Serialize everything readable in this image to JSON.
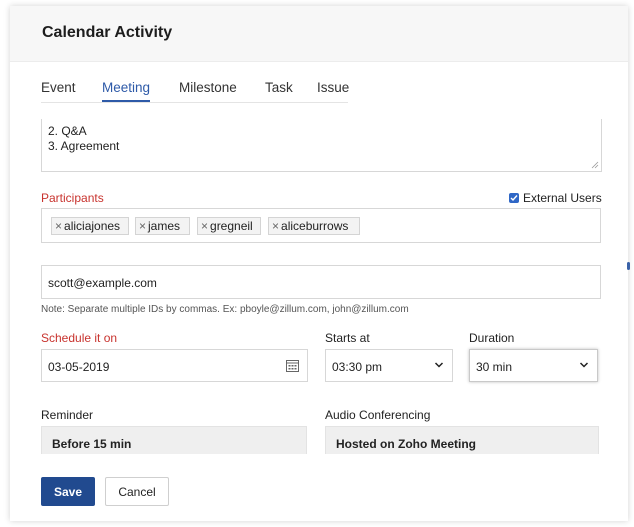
{
  "dialog": {
    "title": "Calendar Activity"
  },
  "tabs": [
    {
      "label": "Event"
    },
    {
      "label": "Meeting"
    },
    {
      "label": "Milestone"
    },
    {
      "label": "Task"
    },
    {
      "label": "Issue"
    }
  ],
  "active_tab": "Meeting",
  "description": {
    "lines": [
      "2. Q&A",
      "3. Agreement"
    ]
  },
  "participants": {
    "label": "Participants",
    "external_users_label": "External Users",
    "external_users_checked": true,
    "chips": [
      "aliciajones",
      "james",
      "gregneil",
      "aliceburrows"
    ]
  },
  "external_emails": {
    "value": "scott@example.com",
    "note": "Note: Separate multiple IDs by commas. Ex: pboyle@zillum.com, john@zillum.com"
  },
  "schedule": {
    "label": "Schedule it on",
    "date": "03-05-2019",
    "starts_at_label": "Starts at",
    "starts_at": "03:30 pm",
    "duration_label": "Duration",
    "duration": "30 min"
  },
  "reminder": {
    "label": "Reminder",
    "value": "Before 15 min"
  },
  "audio_conferencing": {
    "label": "Audio Conferencing",
    "value": "Hosted on Zoho Meeting"
  },
  "buttons": {
    "save": "Save",
    "cancel": "Cancel"
  },
  "colors": {
    "accent": "#2e5aa8",
    "primary_button": "#214a8f",
    "required_label": "#c8332e"
  }
}
